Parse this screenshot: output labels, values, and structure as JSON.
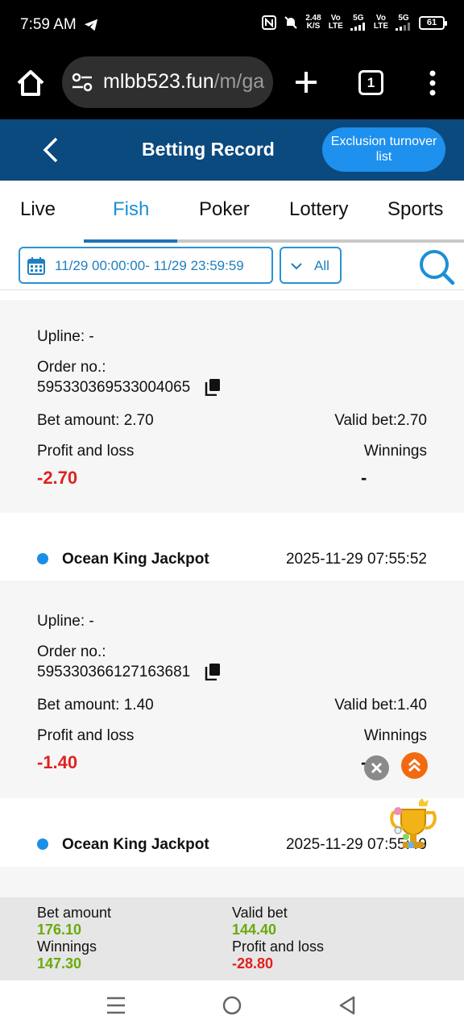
{
  "status_bar": {
    "time": "7:59 AM",
    "speed_value": "2.48",
    "speed_unit": "K/S",
    "sim1_top": "Vo",
    "sim1_bottom": "LTE",
    "net1": "5G",
    "sim2_top": "Vo",
    "sim2_bottom": "LTE",
    "net2": "5G",
    "battery": "61",
    "icons": [
      "telegram-icon",
      "nfc-icon",
      "mute-icon",
      "signal-icon",
      "battery-icon"
    ]
  },
  "browser": {
    "url_main": "mlbb523.fun",
    "url_path": "/m/ga",
    "tab_count": "1",
    "icons": [
      "home-icon",
      "tune-icon",
      "plus-icon",
      "more-icon"
    ]
  },
  "header": {
    "title": "Betting Record",
    "exclusion_button": "Exclusion turnover list",
    "background_color": "#0b4a7e",
    "button_color": "#1e90ee"
  },
  "tabs": [
    {
      "label": "Live",
      "active": false
    },
    {
      "label": "Fish",
      "active": true
    },
    {
      "label": "Poker",
      "active": false
    },
    {
      "label": "Lottery",
      "active": false
    },
    {
      "label": "Sports",
      "active": false
    }
  ],
  "filter": {
    "date_range": "11/29 00:00:00- 11/29 23:59:59",
    "status_select": "All"
  },
  "records": [
    {
      "upline": "Upline: -",
      "order_label": "Order no.:",
      "order_no": "595330369533004065",
      "bet_amount": "Bet amount: 2.70",
      "valid_bet": "Valid bet:2.70",
      "profit_label": "Profit and loss",
      "profit_value": "-2.70",
      "winnings_label": "Winnings",
      "winnings_value": "-"
    },
    {
      "game": "Ocean King Jackpot",
      "time": "2025-11-29 07:55:52",
      "upline": "Upline: -",
      "order_label": "Order no.:",
      "order_no": "595330366127163681",
      "bet_amount": "Bet amount: 1.40",
      "valid_bet": "Valid bet:1.40",
      "profit_label": "Profit and loss",
      "profit_value": "-1.40",
      "winnings_label": "Winnings",
      "winnings_value": "-"
    },
    {
      "game": "Ocean King Jackpot",
      "time": "2025-11-29 07:55:49"
    }
  ],
  "summary": {
    "bet_amount_label": "Bet amount",
    "bet_amount_value": "176.10",
    "valid_bet_label": "Valid bet",
    "valid_bet_value": "144.40",
    "winnings_label": "Winnings",
    "winnings_value": "147.30",
    "profit_label": "Profit and loss",
    "profit_value": "-28.80",
    "positive_color": "#6aaa0c",
    "negative_color": "#e0211f"
  },
  "nav_bar": {
    "icons": [
      "recents-icon",
      "home-circle-icon",
      "back-triangle-icon"
    ]
  }
}
